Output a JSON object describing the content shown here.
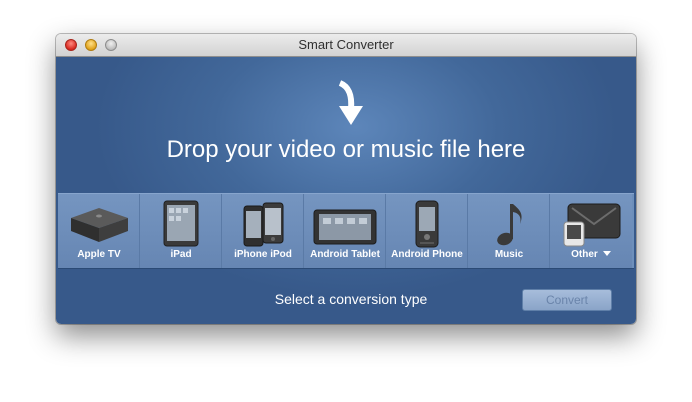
{
  "window": {
    "title": "Smart Converter"
  },
  "drop_zone": {
    "text": "Drop your video or music file here"
  },
  "devices": [
    {
      "label": "Apple TV",
      "icon": "apple-tv-icon"
    },
    {
      "label": "iPad",
      "icon": "ipad-icon"
    },
    {
      "label": "iPhone iPod",
      "icon": "iphone-ipod-icon"
    },
    {
      "label": "Android Tablet",
      "icon": "android-tablet-icon"
    },
    {
      "label": "Android Phone",
      "icon": "android-phone-icon"
    },
    {
      "label": "Music",
      "icon": "music-note-icon"
    },
    {
      "label": "Other",
      "icon": "other-devices-icon"
    }
  ],
  "footer": {
    "status": "Select a conversion type",
    "convert_label": "Convert",
    "convert_enabled": false
  },
  "colors": {
    "content_bg": "#42689a",
    "accent": "#ffffff"
  }
}
